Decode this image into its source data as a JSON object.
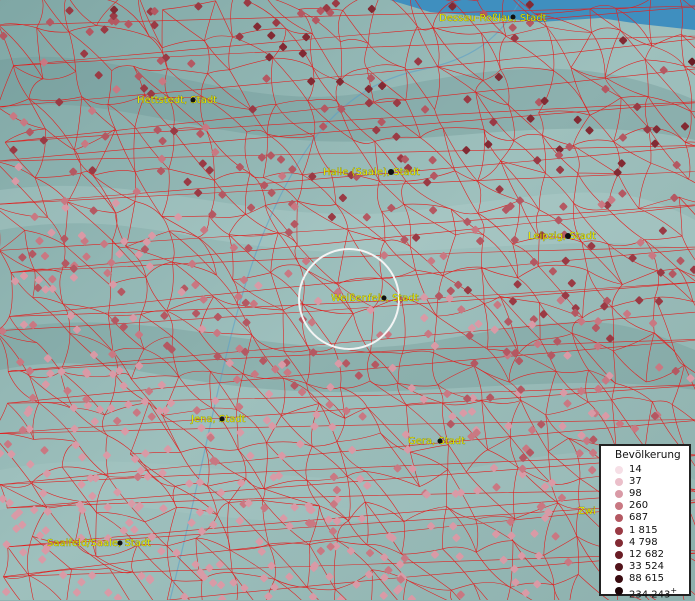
{
  "map": {
    "water_color": "#3f8fbf",
    "boundary_color": "#e02020",
    "cities": [
      {
        "name": "Dessau-Roßlau, Stadt"
      },
      {
        "name": "Hettstedt, Stadt"
      },
      {
        "name": "Halle (Saale), Stadt"
      },
      {
        "name": "Leipzig, Stadt"
      },
      {
        "name": "Weißenfels, Stadt"
      },
      {
        "name": "Jena, Stadt"
      },
      {
        "name": "Gera, Stadt"
      },
      {
        "name": "Saalfeld/Saale, Stadt"
      },
      {
        "name": "Zwi"
      }
    ]
  },
  "legend": {
    "title": "Bevölkerung",
    "items": [
      {
        "label": "14",
        "color": "#f6dfe6"
      },
      {
        "label": "37",
        "color": "#ebbfca"
      },
      {
        "label": "98",
        "color": "#d99aa6"
      },
      {
        "label": "260",
        "color": "#c97882"
      },
      {
        "label": "687",
        "color": "#b45862"
      },
      {
        "label": "1 815",
        "color": "#9a3a44"
      },
      {
        "label": "4 798",
        "color": "#822a33"
      },
      {
        "label": "12 682",
        "color": "#6a1d25"
      },
      {
        "label": "33 524",
        "color": "#52131a"
      },
      {
        "label": "88 615",
        "color": "#3a0b10"
      },
      {
        "label": "234 243",
        "color": "#1e0508",
        "suffix": "+"
      }
    ]
  }
}
